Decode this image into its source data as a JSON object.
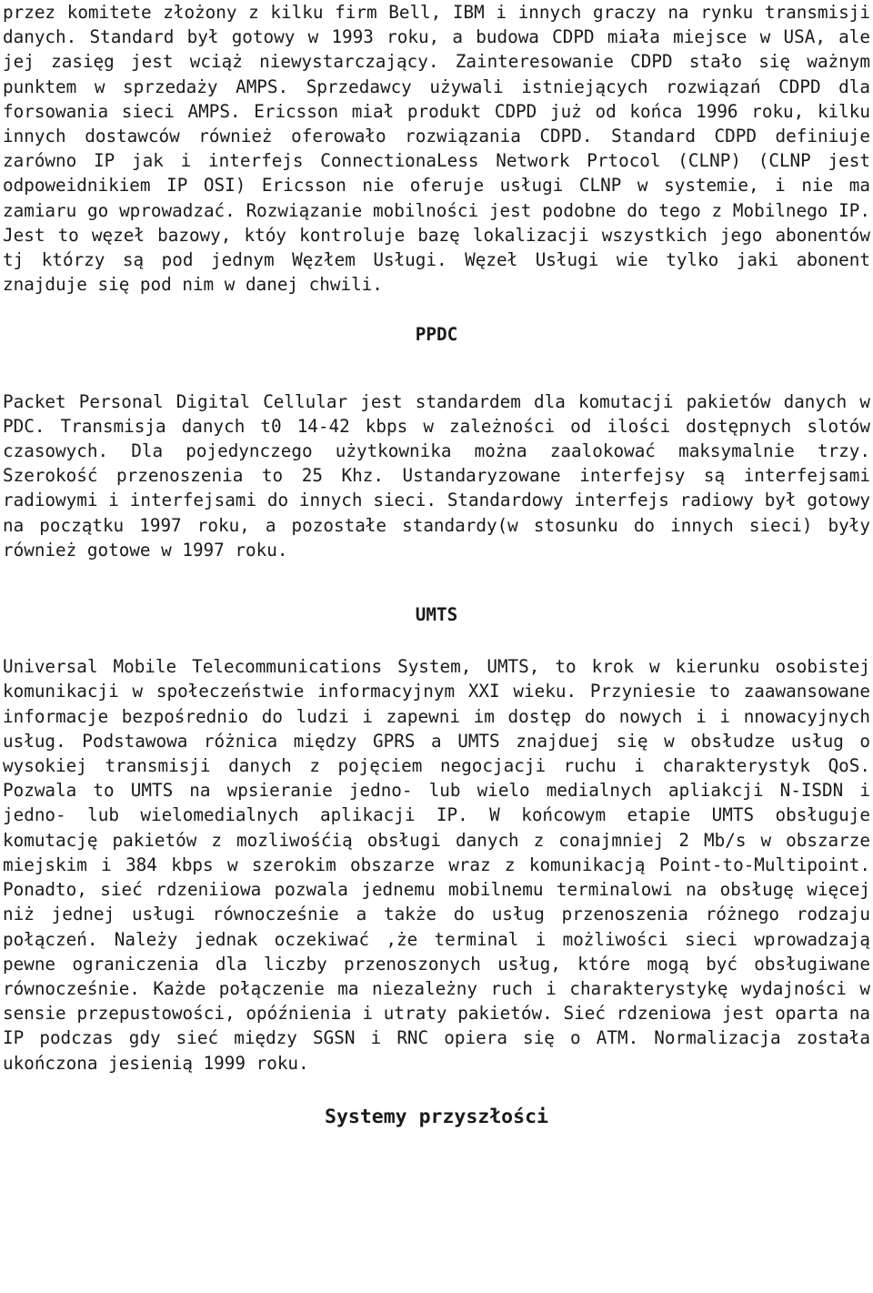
{
  "document": {
    "language": "pl",
    "background_color": "#ffffff",
    "text_color": "#1a1a1a",
    "sections": [
      {
        "id": "cdpd-continued",
        "type": "paragraph",
        "text": "przez komitete złożony z kilku firm Bell, IBM i innych graczy na rynku transmisji danych. Standard był gotowy w 1993 roku, a budowa CDPD miała miejsce w USA, ale jej zasięg jest wciąż niewystarczający. Zainteresowanie CDPD stało się ważnym punktem w sprzedaży AMPS. Sprzedawcy używali istniejących rozwiązań CDPD dla forsowania sieci AMPS. Ericsson miał produkt CDPD już od końca 1996 roku, kilku innych dostawców również oferowało rozwiązania CDPD. Standard CDPD definiuje zarówno IP jak i interfejs ConnectionaLess Network Prtocol (CLNP) (CLNP jest odpoweidnikiem IP OSI) Ericsson nie oferuje usługi CLNP w systemie, i nie ma zamiaru go wprowadzać. Rozwiązanie mobilności jest podobne do tego z Mobilnego IP. Jest to węzeł bazowy, któy kontroluje bazę lokalizacji wszystkich jego abonentów tj którzy są pod jednym Węzłem Usługi. Węzeł Usługi wie tylko jaki abonent znajduje się pod nim w danej chwili."
      },
      {
        "id": "ppdc-heading",
        "type": "heading",
        "text": "PPDC"
      },
      {
        "id": "ppdc-body",
        "type": "paragraph",
        "text": "Packet Personal Digital Cellular jest standardem dla komutacji pakietów danych w PDC. Transmisja danych t0 14-42 kbps w zależności od ilości dostępnych slotów czasowych. Dla pojedynczego użytkownika można zaalokować maksymalnie trzy. Szerokość przenoszenia to 25 Khz. Ustandaryzowane interfejsy są interfejsami radiowymi i interfejsami do innych sieci. Standardowy interfejs radiowy był gotowy na początku 1997 roku, a pozostałe standardy(w stosunku do innych sieci) były również gotowe w 1997 roku."
      },
      {
        "id": "umts-heading",
        "type": "heading",
        "text": "UMTS"
      },
      {
        "id": "umts-body",
        "type": "paragraph",
        "text": "Universal Mobile Telecommunications System, UMTS, to krok w kierunku osobistej komunikacji w społeczeństwie informacyjnym XXI wieku. Przyniesie to zaawansowane informacje bezpośrednio do ludzi i zapewni im dostęp do nowych i i nnowacyjnych usług. Podstawowa różnica między GPRS a UMTS znajduej się w obsłudze usług o wysokiej transmisji danych z pojęciem negocjacji ruchu i charakterystyk QoS. Pozwala to UMTS na wpsieranie jedno- lub wielo medialnych apliakcji N-ISDN i jedno- lub wielomedialnych aplikacji IP. W końcowym etapie UMTS obsługuje komutację pakietów z mozliwośćią obsługi danych z conajmniej 2 Mb/s w obszarze miejskim i 384 kbps w szerokim obszarze wraz z komunikacją Point-to-Multipoint. Ponadto, sieć rdzeniiowa pozwala jednemu mobilnemu terminalowi na obsługę więcej niż jednej usługi równocześnie a także do usług przenoszenia różnego rodzaju połączeń. Należy jednak oczekiwać ,że terminal i możliwości sieci wprowadzają pewne ograniczenia dla liczby przenoszonych usług, które mogą być obsługiwane równocześnie. Każde połączenie ma niezależny ruch i charakterystykę wydajności w sensie przepustowości, opóźnienia i utraty pakietów. Sieć rdzeniowa jest oparta na IP podczas gdy sieć między SGSN i RNC opiera się o ATM. Normalizacja została ukończona jesienią 1999 roku."
      },
      {
        "id": "future-systems-heading",
        "type": "heading",
        "text": "Systemy przyszłości"
      }
    ]
  }
}
